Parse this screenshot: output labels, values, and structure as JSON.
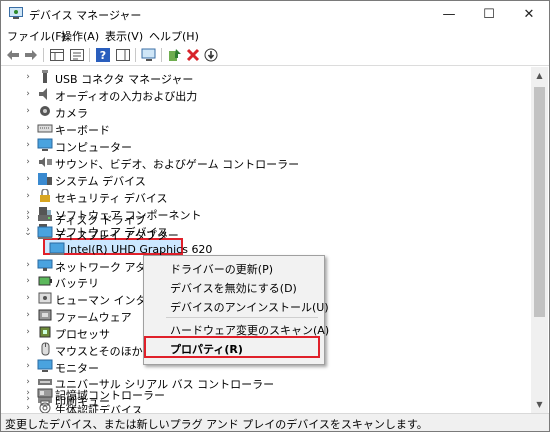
{
  "window": {
    "title": "デバイス マネージャー"
  },
  "menu": [
    "ファイル(F)",
    "操作(A)",
    "表示(V)",
    "ヘルプ(H)"
  ],
  "toolbar_icons": [
    "back-arrow-icon",
    "forward-arrow-icon",
    "show-hide-tree-icon",
    "properties-icon",
    "help-icon",
    "action-pane-icon",
    "scan-hardware-icon",
    "update-driver-icon",
    "uninstall-icon",
    "disable-icon"
  ],
  "tree": {
    "items": [
      {
        "label": "USB コネクタ マネージャー",
        "icon": "usb-icon"
      },
      {
        "label": "オーディオの入力および出力",
        "icon": "speaker-icon"
      },
      {
        "label": "カメラ",
        "icon": "camera-icon"
      },
      {
        "label": "キーボード",
        "icon": "keyboard-icon"
      },
      {
        "label": "コンピューター",
        "icon": "computer-icon"
      },
      {
        "label": "サウンド、ビデオ、およびゲーム コントローラー",
        "icon": "sound-icon"
      },
      {
        "label": "システム デバイス",
        "icon": "system-icon"
      },
      {
        "label": "セキュリティ デバイス",
        "icon": "security-icon"
      },
      {
        "label": "ソフトウェア コンポーネント",
        "icon": "software-component-icon"
      },
      {
        "label": "ソフトウェア デバイス",
        "icon": "software-device-icon"
      },
      {
        "label": "ディスク ドライブ",
        "icon": "disk-icon"
      },
      {
        "label": "ディスプレイ アダプター",
        "icon": "display-adapter-icon",
        "expanded": true
      },
      {
        "label": "Intel(R) UHD Graphics 620",
        "icon": "display-adapter-icon",
        "child": true,
        "selected": true
      },
      {
        "label": "ネットワーク アダプター",
        "icon": "network-icon"
      },
      {
        "label": "バッテリ",
        "icon": "battery-icon"
      },
      {
        "label": "ヒューマン インターフェイス",
        "icon": "hid-icon"
      },
      {
        "label": "ファームウェア",
        "icon": "firmware-icon"
      },
      {
        "label": "プロセッサ",
        "icon": "processor-icon"
      },
      {
        "label": "マウスとそのほかのポ",
        "icon": "mouse-icon"
      },
      {
        "label": "モニター",
        "icon": "monitor-icon"
      },
      {
        "label": "ユニバーサル シリアル バス コントローラー",
        "icon": "usb-controller-icon"
      },
      {
        "label": "印刷キュー",
        "icon": "printer-icon"
      },
      {
        "label": "記憶域コントローラー",
        "icon": "storage-icon"
      },
      {
        "label": "生体認証デバイス",
        "icon": "biometric-icon"
      }
    ]
  },
  "context_menu": {
    "items": [
      {
        "label": "ドライバーの更新(P)"
      },
      {
        "label": "デバイスを無効にする(D)"
      },
      {
        "label": "デバイスのアンインストール(U)"
      },
      {
        "label": "ハードウェア変更のスキャン(A)"
      },
      {
        "label": "プロパティ(R)",
        "bold": true
      }
    ]
  },
  "status": {
    "text": "変更したデバイス、または新しいプラグ アンド プレイのデバイスをスキャンします。"
  },
  "colors": {
    "highlight_border": "#e0202a",
    "selection_bg": "#cce8ff"
  }
}
